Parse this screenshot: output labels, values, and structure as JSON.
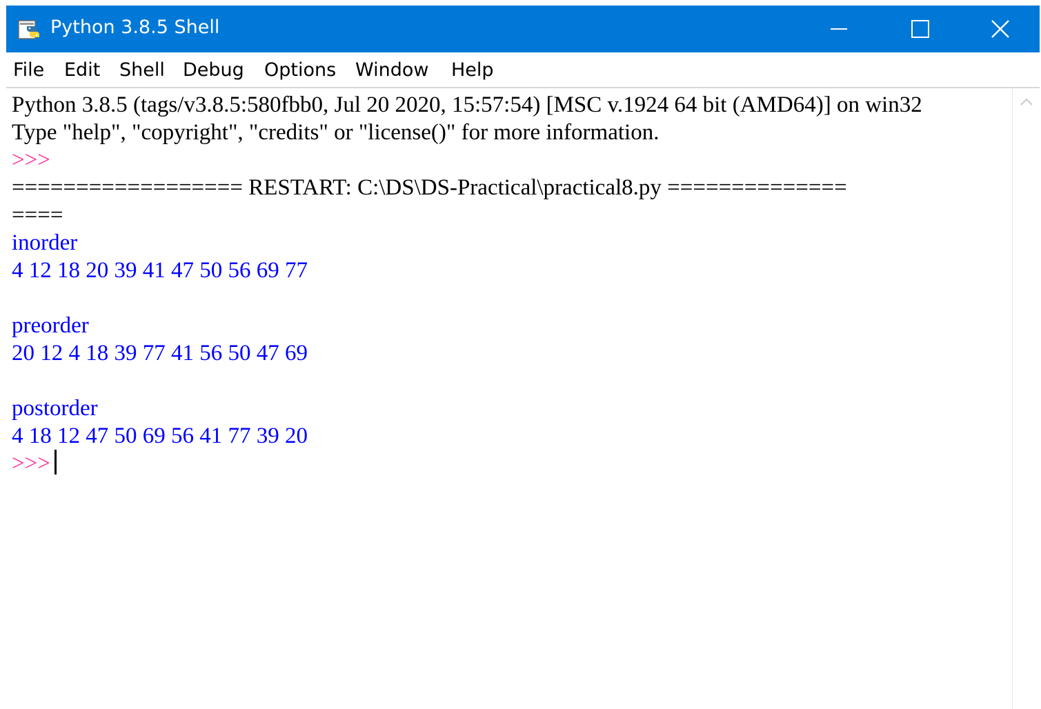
{
  "window": {
    "title": "Python 3.8.5 Shell",
    "accent": "#0078d7",
    "icons": {
      "app": "python-idle-icon",
      "minimize": "minimize-icon",
      "maximize": "maximize-icon",
      "close": "close-icon"
    }
  },
  "menu": {
    "file": "File",
    "edit": "Edit",
    "shell": "Shell",
    "debug": "Debug",
    "options": "Options",
    "window": "Window",
    "help": "Help"
  },
  "shell": {
    "banner1": "Python 3.8.5 (tags/v3.8.5:580fbb0, Jul 20 2020, 15:57:54) [MSC v.1924 64 bit (AMD64)] on win32",
    "banner2": "Type \"help\", \"copyright\", \"credits\" or \"license()\" for more information.",
    "prompt": ">>>",
    "restart1": "================== RESTART: C:\\DS\\DS-Practical\\practical8.py ==============",
    "restart2": "====",
    "inorder_label": "inorder",
    "inorder_values": "4 12 18 20 39 41 47 50 56 69 77",
    "preorder_label": "preorder",
    "preorder_values": "20 12 4 18 39 77 41 56 50 47 69",
    "postorder_label": "postorder",
    "postorder_values": "4 18 12 47 50 69 56 41 77 39 20",
    "colors": {
      "output": "#0000ff",
      "prompt": "#ff2d9a",
      "stdout": "#000000"
    }
  }
}
